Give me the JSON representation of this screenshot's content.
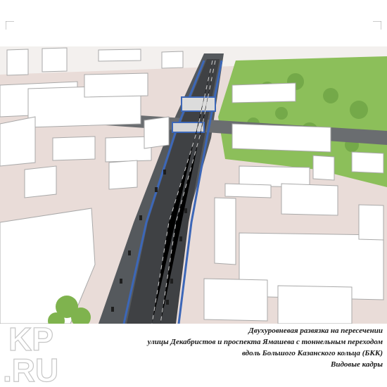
{
  "caption": {
    "line1": "Двухуровневая развязка на пересечении",
    "line2": "улицы Декабристов и проспекта Ямашева с тоннельным переходом",
    "line3": "вдоль Большого Казанского кольца (БКК)",
    "line4": "Видовые кадры"
  },
  "watermark": {
    "text_top": "KP",
    "text_bottom": ".RU"
  },
  "colors": {
    "road": "#555a5e",
    "tunnel_edge": "#3c67b8",
    "park": "#8cbf5a",
    "ground": "#e9dcd8"
  }
}
